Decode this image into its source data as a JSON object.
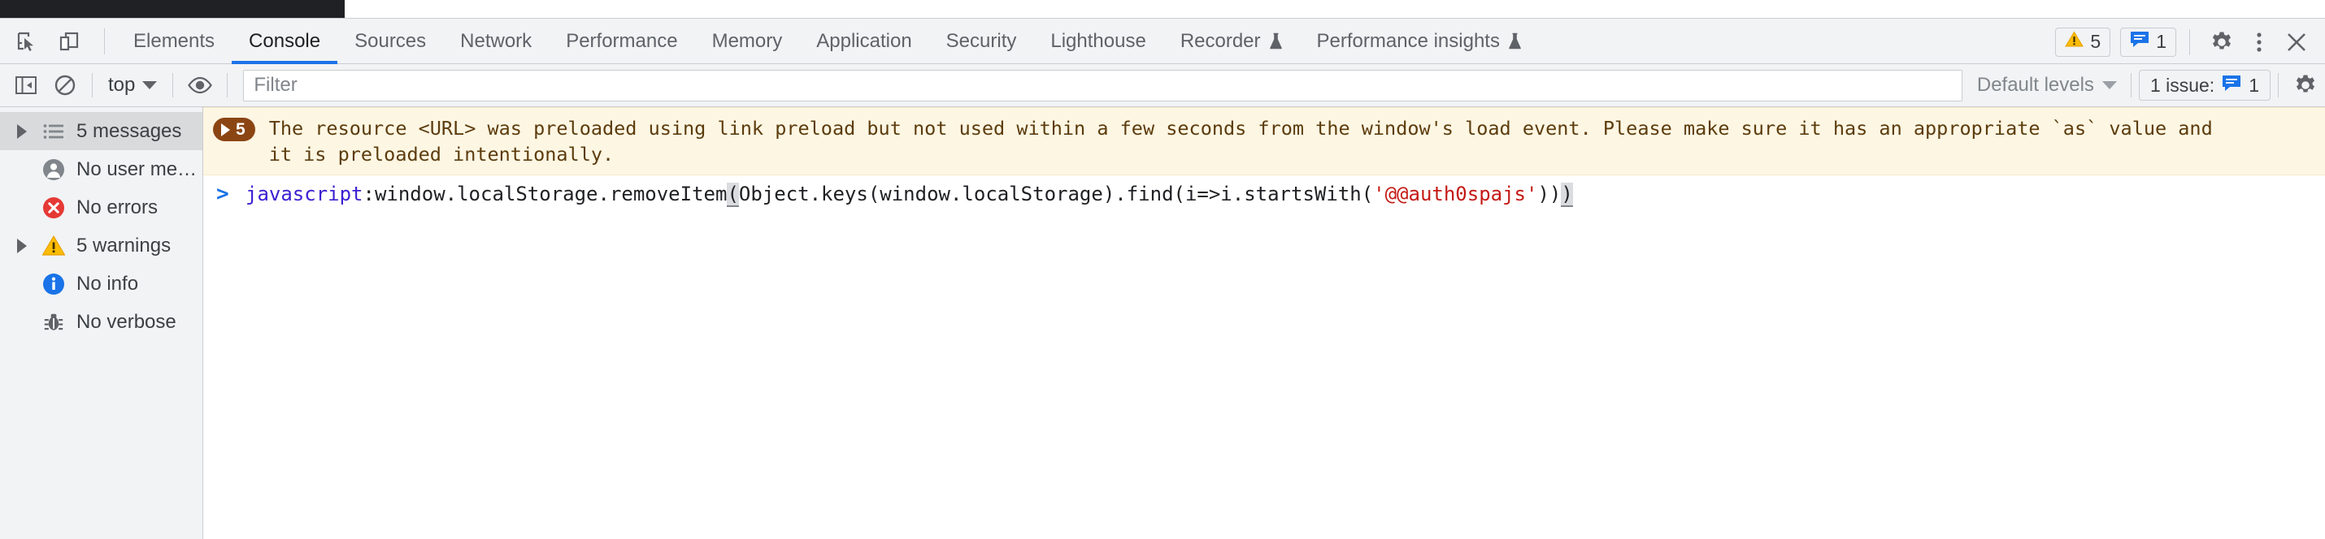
{
  "window": {
    "title": "Chrome DevTools - Console"
  },
  "tabbar": {
    "inspect_icon": "inspect-element-icon",
    "device_icon": "device-toolbar-icon",
    "tabs": [
      {
        "label": "Elements",
        "active": false,
        "experimental": false
      },
      {
        "label": "Console",
        "active": true,
        "experimental": false
      },
      {
        "label": "Sources",
        "active": false,
        "experimental": false
      },
      {
        "label": "Network",
        "active": false,
        "experimental": false
      },
      {
        "label": "Performance",
        "active": false,
        "experimental": false
      },
      {
        "label": "Memory",
        "active": false,
        "experimental": false
      },
      {
        "label": "Application",
        "active": false,
        "experimental": false
      },
      {
        "label": "Security",
        "active": false,
        "experimental": false
      },
      {
        "label": "Lighthouse",
        "active": false,
        "experimental": false
      },
      {
        "label": "Recorder",
        "active": false,
        "experimental": true
      },
      {
        "label": "Performance insights",
        "active": false,
        "experimental": true
      }
    ],
    "warning_count": "5",
    "issue_count": "1",
    "settings_icon": "gear-icon",
    "more_icon": "kebab-menu-icon",
    "close_icon": "close-icon",
    "active_tab_color": "#1a73e8"
  },
  "toolbar": {
    "sidebar_toggle_icon": "sidebar-toggle-icon",
    "clear_icon": "clear-console-icon",
    "context_value": "top",
    "eye_icon": "live-expression-eye-icon",
    "filter_placeholder": "Filter",
    "filter_value": "",
    "levels_value": "Default levels",
    "issues_label": "1 issue:",
    "issues_count": "1",
    "settings_icon": "console-settings-gear-icon"
  },
  "sidebar": {
    "items": [
      {
        "label": "5 messages",
        "icon": "list-icon",
        "twisty": true,
        "selected": true
      },
      {
        "label": "No user me…",
        "icon": "user-icon",
        "twisty": false,
        "selected": false
      },
      {
        "label": "No errors",
        "icon": "error-icon",
        "twisty": false,
        "selected": false
      },
      {
        "label": "5 warnings",
        "icon": "warning-icon",
        "twisty": true,
        "selected": false
      },
      {
        "label": "No info",
        "icon": "info-icon",
        "twisty": false,
        "selected": false
      },
      {
        "label": "No verbose",
        "icon": "bug-icon",
        "twisty": false,
        "selected": false
      }
    ]
  },
  "console": {
    "message": {
      "group_count": "5",
      "line1": "The resource <URL> was preloaded using link preload but not used within a few seconds from the window's load event. Please make sure it has an appropriate `as` value and",
      "line2": "it is preloaded intentionally.",
      "background_color": "#fdf6e3",
      "text_color": "#5c3c0d",
      "badge_color": "#8b4513"
    },
    "input": {
      "prompt": ">",
      "scheme": "javascript",
      "colon": ":",
      "expr_a": "window.localStorage.removeItem",
      "paren_open": "(",
      "expr_b": "Object.keys(window.localStorage).find(i=>i.startsWith(",
      "string": "'@@auth0spajs'",
      "parens_close_a": "))",
      "paren_close_hl": ")"
    }
  }
}
